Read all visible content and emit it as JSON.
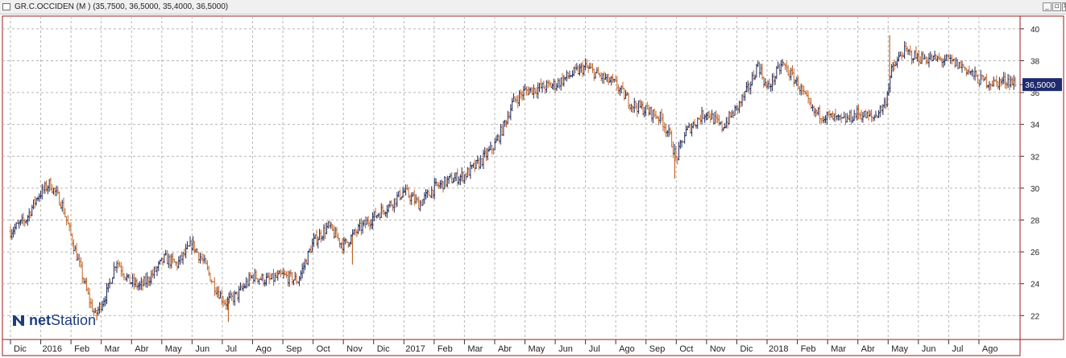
{
  "window": {
    "title": "GR.C.OCCIDEN (M ) (35,7500, 36,5000, 35,4000, 36,5000)",
    "buttons": [
      {
        "name": "minimize-button",
        "glyph": "_"
      },
      {
        "name": "restore-button",
        "glyph": "▫"
      },
      {
        "name": "close-button",
        "glyph": "✕"
      }
    ]
  },
  "logo": {
    "text_bold": "net",
    "text": "Station"
  },
  "colors": {
    "frame": "#9b1b1b",
    "grid": "#b5b5b5",
    "bar_up": "#1e2a5c",
    "bar_down": "#c1652a",
    "last_price_box": "#1f2b6e",
    "logo": "#1c3f7c"
  },
  "chart_data": {
    "type": "bar",
    "subtype": "ohlc",
    "symbol": "GR.C.OCCIDEN (M )",
    "last_ohlc": {
      "open": "35,7500",
      "high": "36,5000",
      "low": "35,4000",
      "close": "36,5000"
    },
    "last_price_label": "36,5000",
    "last_price": 36.5,
    "grid": true,
    "y_axis": {
      "position": "right",
      "min": 20.5,
      "max": 40.8,
      "ticks": [
        22,
        24,
        26,
        28,
        30,
        32,
        34,
        36,
        38,
        40
      ]
    },
    "x_axis_labels": [
      "Dic",
      "2016",
      "Feb",
      "Mar",
      "Abr",
      "May",
      "Jun",
      "Jul",
      "Ago",
      "Sep",
      "Oct",
      "Nov",
      "Dic",
      "2017",
      "Feb",
      "Mar",
      "Abr",
      "May",
      "Jun",
      "Jul",
      "Ago",
      "Sep",
      "Oct",
      "Nov",
      "Dic",
      "2018",
      "Feb",
      "Mar",
      "Abr",
      "May",
      "Jun",
      "Jul",
      "Ago"
    ],
    "x_range_months": [
      0,
      33.2
    ],
    "price_path": [
      [
        0,
        27.3
      ],
      [
        0.5,
        28.0
      ],
      [
        0.9,
        29.5
      ],
      [
        1.3,
        30.3
      ],
      [
        1.7,
        29.0
      ],
      [
        2.0,
        27.0
      ],
      [
        2.3,
        25.0
      ],
      [
        2.6,
        23.0
      ],
      [
        2.8,
        22.0
      ],
      [
        3.2,
        23.5
      ],
      [
        3.5,
        25.5
      ],
      [
        3.9,
        24.2
      ],
      [
        4.3,
        23.8
      ],
      [
        4.7,
        24.6
      ],
      [
        5.1,
        25.6
      ],
      [
        5.5,
        25.2
      ],
      [
        6.0,
        26.5
      ],
      [
        6.4,
        25.3
      ],
      [
        6.7,
        24.0
      ],
      [
        7.1,
        22.8
      ],
      [
        7.5,
        23.3
      ],
      [
        8.0,
        24.5
      ],
      [
        8.5,
        24.2
      ],
      [
        9.0,
        24.5
      ],
      [
        9.5,
        24.2
      ],
      [
        10.0,
        26.6
      ],
      [
        10.5,
        27.6
      ],
      [
        11.0,
        26.4
      ],
      [
        11.5,
        27.4
      ],
      [
        12.0,
        28.2
      ],
      [
        12.5,
        28.9
      ],
      [
        13.0,
        29.8
      ],
      [
        13.5,
        29.0
      ],
      [
        14.0,
        30.0
      ],
      [
        14.5,
        30.5
      ],
      [
        15.0,
        30.8
      ],
      [
        15.5,
        31.6
      ],
      [
        16.0,
        32.7
      ],
      [
        16.3,
        33.9
      ],
      [
        16.6,
        35.4
      ],
      [
        17.0,
        36.1
      ],
      [
        17.5,
        36.3
      ],
      [
        18.0,
        36.5
      ],
      [
        18.5,
        37.1
      ],
      [
        19.0,
        37.6
      ],
      [
        19.5,
        37.0
      ],
      [
        20.0,
        36.5
      ],
      [
        20.5,
        35.3
      ],
      [
        21.0,
        34.9
      ],
      [
        21.5,
        34.4
      ],
      [
        21.8,
        33.2
      ],
      [
        22.0,
        31.8
      ],
      [
        22.3,
        33.5
      ],
      [
        22.7,
        34.3
      ],
      [
        23.0,
        34.8
      ],
      [
        23.5,
        33.8
      ],
      [
        24.0,
        35.0
      ],
      [
        24.4,
        36.3
      ],
      [
        24.7,
        37.8
      ],
      [
        25.0,
        36.2
      ],
      [
        25.5,
        37.8
      ],
      [
        26.0,
        36.6
      ],
      [
        26.5,
        34.8
      ],
      [
        27.0,
        34.5
      ],
      [
        27.5,
        34.2
      ],
      [
        28.0,
        34.7
      ],
      [
        28.5,
        34.4
      ],
      [
        28.9,
        35.3
      ],
      [
        29.1,
        37.3
      ],
      [
        29.5,
        38.6
      ],
      [
        30.0,
        38.2
      ],
      [
        30.5,
        38.1
      ],
      [
        31.0,
        38.0
      ],
      [
        31.5,
        37.6
      ],
      [
        32.0,
        36.8
      ],
      [
        32.5,
        36.6
      ],
      [
        33.0,
        36.8
      ],
      [
        33.2,
        36.5
      ]
    ],
    "spikes": [
      {
        "month": 2.85,
        "low": 21.7
      },
      {
        "month": 7.2,
        "low": 21.6
      },
      {
        "month": 11.3,
        "low": 25.2
      },
      {
        "month": 21.95,
        "low": 30.6
      },
      {
        "month": 29.05,
        "high": 39.6
      }
    ]
  }
}
